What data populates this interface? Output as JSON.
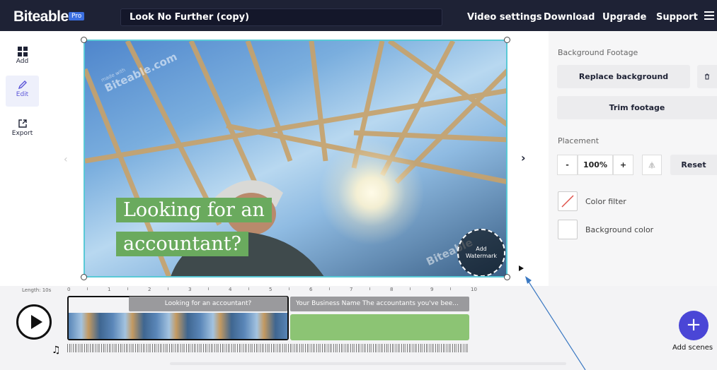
{
  "header": {
    "logo": "Biteable",
    "pro_badge": "Pro",
    "project_title": "Look No Further (copy)",
    "nav": [
      "Video settings",
      "Download",
      "Upgrade",
      "Support"
    ]
  },
  "sidebar": {
    "items": [
      {
        "label": "Add",
        "icon": "grid-icon"
      },
      {
        "label": "Edit",
        "icon": "pencil-icon"
      },
      {
        "label": "Export",
        "icon": "export-icon"
      }
    ],
    "active": "Edit"
  },
  "canvas": {
    "caption_line1": "Looking for an",
    "caption_line2": "accountant?",
    "watermark_small": "made with",
    "watermark_text": "Biteable.com",
    "watermark_text_2": "Biteable",
    "watermark_button_line1": "Add",
    "watermark_button_line2": "Watermark"
  },
  "right_panel": {
    "section_footage": "Background Footage",
    "replace_button": "Replace background",
    "trim_button": "Trim footage",
    "section_placement": "Placement",
    "zoom_minus": "-",
    "zoom_value": "100%",
    "zoom_plus": "+",
    "reset_button": "Reset",
    "color_filter": "Color filter",
    "background_color": "Background color"
  },
  "timeline": {
    "length": "Length: 10s",
    "ticks": [
      "0",
      "1",
      "2",
      "3",
      "4",
      "5",
      "6",
      "7",
      "8",
      "9",
      "10"
    ],
    "scenes": [
      {
        "label": "Looking for an accountant?"
      },
      {
        "label": "Your Business Name The accountants you've bee..."
      }
    ],
    "add_scenes": "Add scenes",
    "add_glyph": "+"
  },
  "colors": {
    "header_bg": "#1e2235",
    "accent": "#4a46d6",
    "caption_green": "#6aaa5e",
    "selection": "#59c9d6"
  }
}
